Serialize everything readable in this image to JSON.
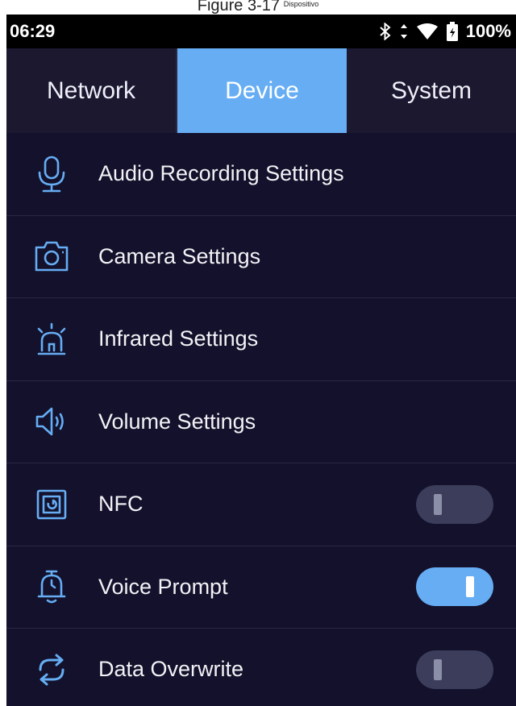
{
  "caption": {
    "text": "Figure 3-17",
    "sub": "Dispositivo"
  },
  "status": {
    "time": "06:29",
    "battery": "100%"
  },
  "tabs": [
    {
      "label": "Network",
      "active": false
    },
    {
      "label": "Device",
      "active": true
    },
    {
      "label": "System",
      "active": false
    }
  ],
  "items": [
    {
      "label": "Audio Recording Settings",
      "icon": "microphone-icon"
    },
    {
      "label": "Camera Settings",
      "icon": "camera-icon"
    },
    {
      "label": "Infrared Settings",
      "icon": "alarm-light-icon"
    },
    {
      "label": "Volume Settings",
      "icon": "speaker-icon"
    },
    {
      "label": "NFC",
      "icon": "nfc-icon",
      "toggle": "off"
    },
    {
      "label": "Voice Prompt",
      "icon": "bell-icon",
      "toggle": "on"
    },
    {
      "label": "Data Overwrite",
      "icon": "overwrite-icon",
      "toggle": "off"
    }
  ],
  "colors": {
    "accent": "#66adf4",
    "background": "#13112b",
    "tab_bar": "#1b1830",
    "toggle_off": "#3b3d5a"
  }
}
